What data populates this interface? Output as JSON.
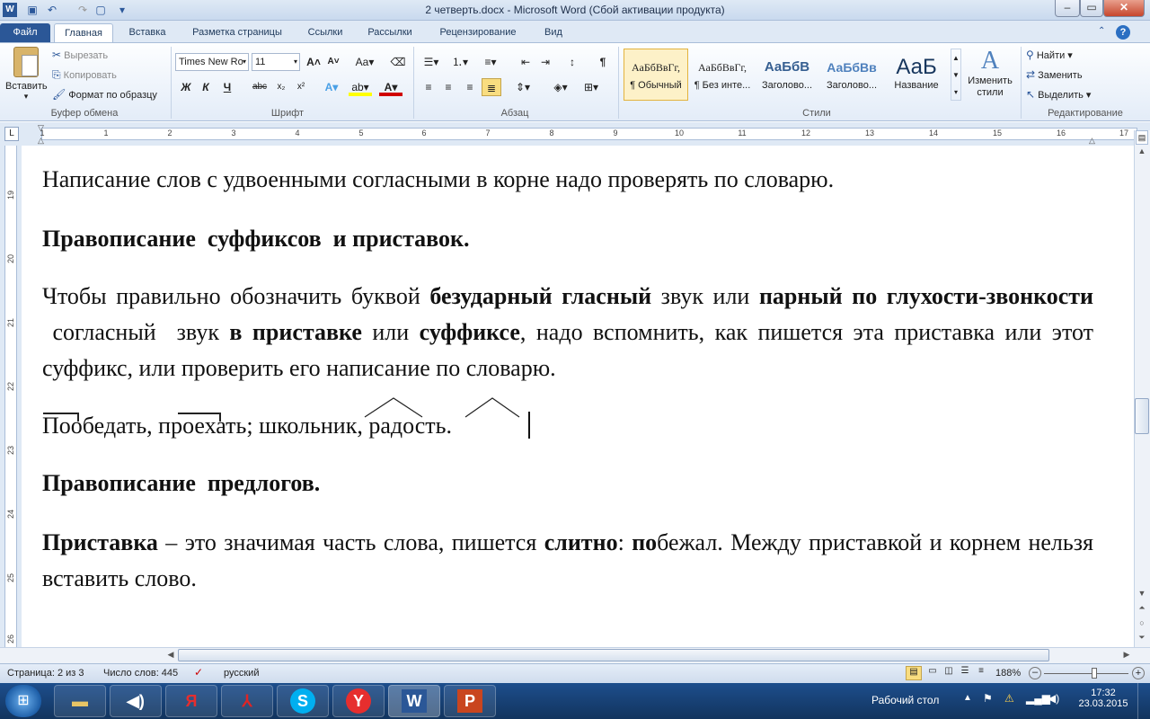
{
  "window": {
    "title": "2 четверть.docx  -  Microsoft Word (Сбой активации продукта)"
  },
  "tabs": [
    "Файл",
    "Главная",
    "Вставка",
    "Разметка страницы",
    "Ссылки",
    "Рассылки",
    "Рецензирование",
    "Вид"
  ],
  "ribbon": {
    "clipboard": {
      "paste": "Вставить",
      "cut": "Вырезать",
      "copy": "Копировать",
      "format_painter": "Формат по образцу",
      "label": "Буфер обмена"
    },
    "font": {
      "name": "Times New Ro",
      "size": "11",
      "label": "Шрифт",
      "bold": "Ж",
      "italic": "К",
      "underline": "Ч",
      "strike": "abc",
      "change_case": "Aa",
      "font_color": "A"
    },
    "paragraph": {
      "label": "Абзац",
      "pilcrow": "¶"
    },
    "styles": {
      "label": "Стили",
      "items": [
        {
          "preview": "АаБбВвГг,",
          "name": "¶ Обычный"
        },
        {
          "preview": "АаБбВвГг,",
          "name": "¶ Без инте..."
        },
        {
          "preview": "АаБбВ",
          "name": "Заголово..."
        },
        {
          "preview": "АаБбВв",
          "name": "Заголово..."
        },
        {
          "preview": "АаБ",
          "name": "Название"
        }
      ],
      "change": "Изменить стили"
    },
    "editing": {
      "label": "Редактирование",
      "find": "Найти",
      "replace": "Заменить",
      "select": "Выделить"
    }
  },
  "ruler": {
    "h": [
      "1",
      "1",
      "2",
      "3",
      "4",
      "5",
      "6",
      "7",
      "8",
      "9",
      "10",
      "11",
      "12",
      "13",
      "14",
      "15",
      "16",
      "17"
    ],
    "v": [
      "19",
      "20",
      "21",
      "22",
      "23",
      "24",
      "25",
      "26"
    ]
  },
  "document": {
    "p1": "Написание слов с удвоенными согласными в корне надо проверять по словарю.",
    "h1": "Правописание  суффиксов  и приставок.",
    "p2a": "Чтобы правильно обозначить буквой ",
    "p2b": "безударный гласный",
    "p2c": " звук или ",
    "p2d": "парный по глухости-звонкости",
    "p2e": " согласный  звук ",
    "p2f": "в приставке",
    "p2g": " или ",
    "p2h": "суффиксе",
    "p2i": ", надо вспомнить, как пишется эта приставка или этот суффикс, или проверить его написание по словарю.",
    "ex": "Пообедать, проехать; школьник, радость.",
    "h2": "Правописание  предлогов.",
    "p3a": "Приставка",
    "p3b": " – это значимая часть слова, пишется ",
    "p3c": "слитно",
    "p3d": ": ",
    "p3e": "по",
    "p3f": "бежал. Между приставкой и корнем нельзя вставить слово."
  },
  "status": {
    "page": "Страница: 2 из 3",
    "words": "Число слов: 445",
    "lang": "русский",
    "zoom": "188%"
  },
  "taskbar": {
    "desktop": "Рабочий стол",
    "time": "17:32",
    "date": "23.03.2015"
  }
}
